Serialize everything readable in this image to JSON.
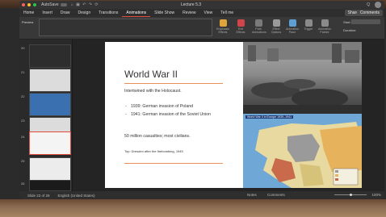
{
  "app": {
    "autosave_label": "AutoSave",
    "doc_title": "Lecture 5.3",
    "search_label": "Q",
    "quick_access": "⌂ ▣ ↶ ↷ ⟳"
  },
  "tabs": [
    {
      "label": "Home"
    },
    {
      "label": "Insert"
    },
    {
      "label": "Draw"
    },
    {
      "label": "Design"
    },
    {
      "label": "Transitions"
    },
    {
      "label": "Animations"
    },
    {
      "label": "Slide Show"
    },
    {
      "label": "Review"
    },
    {
      "label": "View"
    },
    {
      "label": "Tell me"
    }
  ],
  "active_tab_index": 5,
  "share_label": "Share",
  "comments_label": "Comments",
  "ribbon": {
    "preview_label": "Preview",
    "buttons": [
      {
        "label": "Emphasis Effects",
        "color": "#e0a53a"
      },
      {
        "label": "Exit Effects",
        "color": "#d0454a"
      },
      {
        "label": "Path Animations",
        "color": "#7a7a7a"
      },
      {
        "label": "Effect Options",
        "color": "#9a9a9a"
      },
      {
        "label": "Animation Pane",
        "color": "#5ea0d4"
      },
      {
        "label": "Trigger",
        "color": "#8a8a8a"
      },
      {
        "label": "Animation Painter",
        "color": "#8a8a8a"
      }
    ],
    "start_label": "Start:",
    "duration_label": "Duration:"
  },
  "thumbnails": [
    {
      "num": "20",
      "color": "#2d2d2d"
    },
    {
      "num": "21",
      "color": "#dcdcdc"
    },
    {
      "num": "22",
      "color": "#3a6fb0"
    },
    {
      "num": "23",
      "color": "#dcdcdc"
    },
    {
      "num": "24",
      "color": "#f4f4f4"
    },
    {
      "num": "25",
      "color": "#ececec"
    },
    {
      "num": "26",
      "color": "#1b1b1b"
    }
  ],
  "slide": {
    "title": "World War II",
    "intro": "Intertwined with the Holocaust.",
    "bullets": [
      "1939: German invasion of Poland",
      "1941: German invasion of the Soviet Union"
    ],
    "casualties": "50 million casualties; most civilians.",
    "caption": "Top: Dresden after the firebombing, 1945",
    "map_title": "World War II in Europe 1939–1941"
  },
  "status": {
    "slide_info": "Slide 23 of 28",
    "language": "English (United States)",
    "notes_label": "Notes",
    "comments_label": "Comments",
    "zoom": "100%"
  }
}
